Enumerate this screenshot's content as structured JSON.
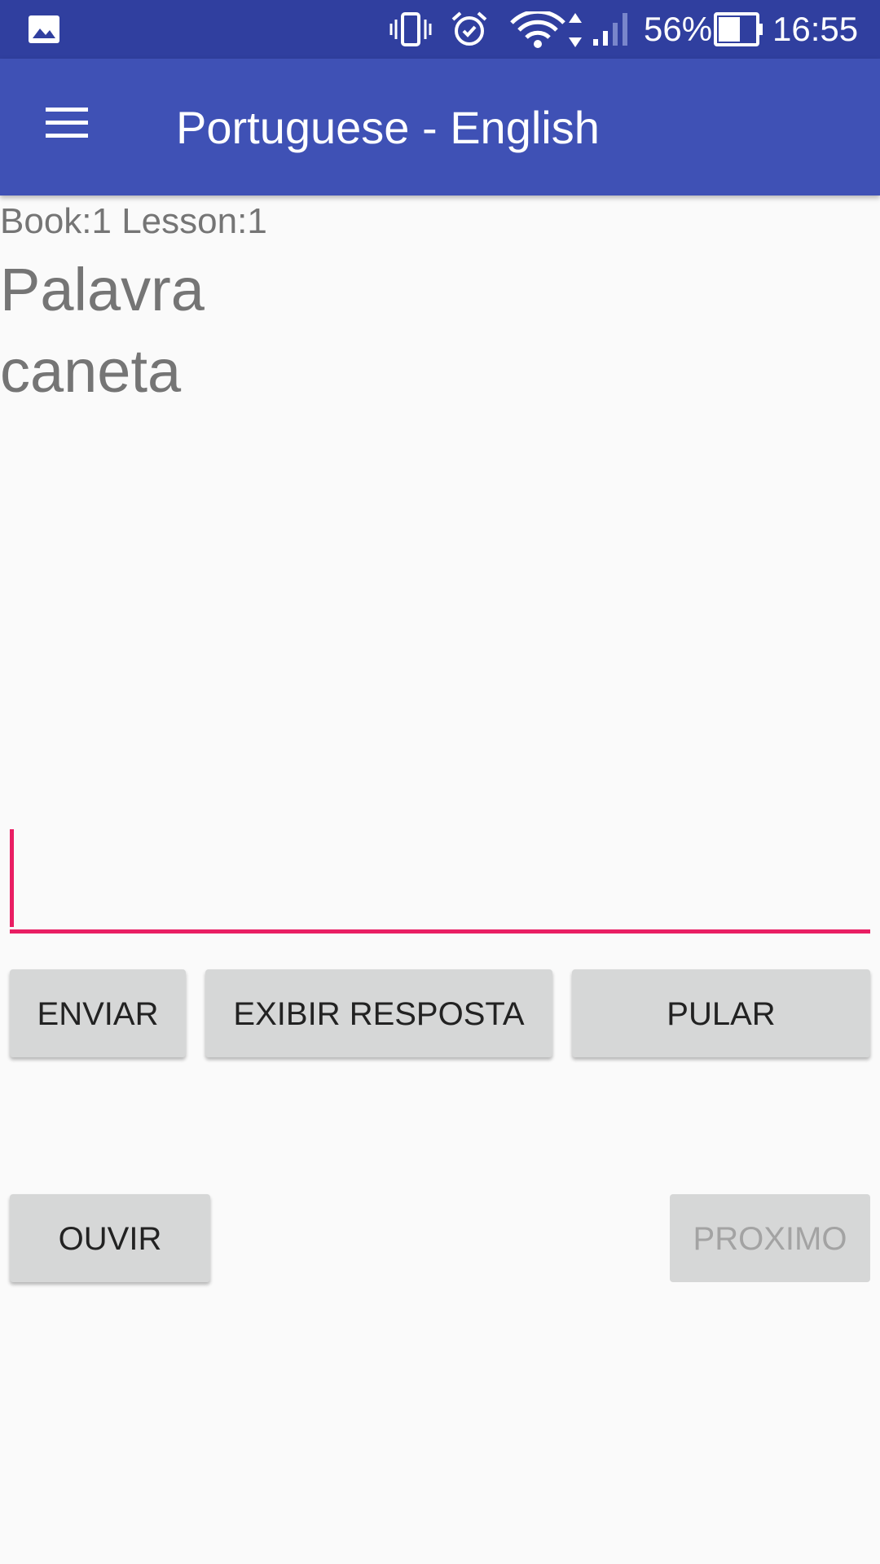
{
  "status_bar": {
    "icons": [
      "gallery-icon",
      "vibrate-icon",
      "alarm-icon",
      "wifi-icon",
      "signal-icon",
      "battery-icon"
    ],
    "battery_percent": "56%",
    "time": "16:55"
  },
  "app_bar": {
    "menu_icon": "menu-icon",
    "title": "Portuguese - English",
    "color": "#3f51b5",
    "status_color": "#303f9f"
  },
  "lesson": {
    "info": "Book:1 Lesson:1",
    "label": "Palavra",
    "word": "caneta"
  },
  "answer": {
    "value": "",
    "accent_color": "#e91e63"
  },
  "buttons": {
    "submit": "ENVIAR",
    "show_answer": "EXIBIR RESPOSTA",
    "skip": "PULAR",
    "listen": "OUVIR",
    "next": "PROXIMO"
  }
}
